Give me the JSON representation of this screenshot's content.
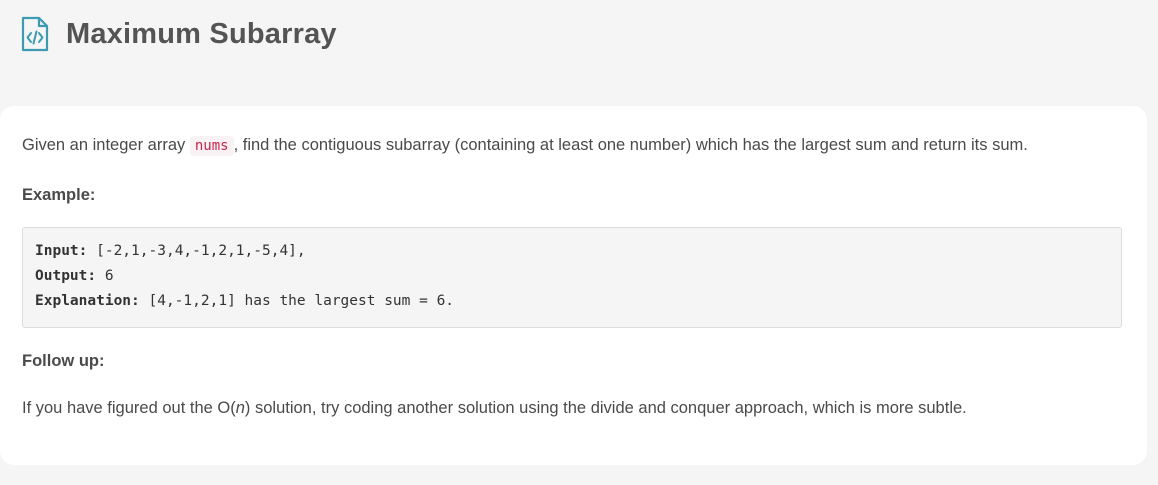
{
  "header": {
    "icon": "file-code-icon",
    "title": "Maximum Subarray"
  },
  "description": {
    "before": "Given an integer array ",
    "code": "nums",
    "after": ", find the contiguous subarray (containing at least one number) which has the largest sum and return its sum."
  },
  "example": {
    "heading": "Example:",
    "input_label": "Input:",
    "input_value": " [-2,1,-3,4,-1,2,1,-5,4],",
    "output_label": "Output:",
    "output_value": " 6",
    "explanation_label": "Explanation:",
    "explanation_value": " [4,-1,2,1] has the largest sum = 6."
  },
  "follow_up": {
    "heading": "Follow up:",
    "before": "If you have figured out the O(",
    "italic": "n",
    "after": ") solution, try coding another solution using the divide and conquer approach, which is more subtle."
  },
  "colors": {
    "accent_icon": "#3c9bb2",
    "inline_code": "#c7254e"
  }
}
